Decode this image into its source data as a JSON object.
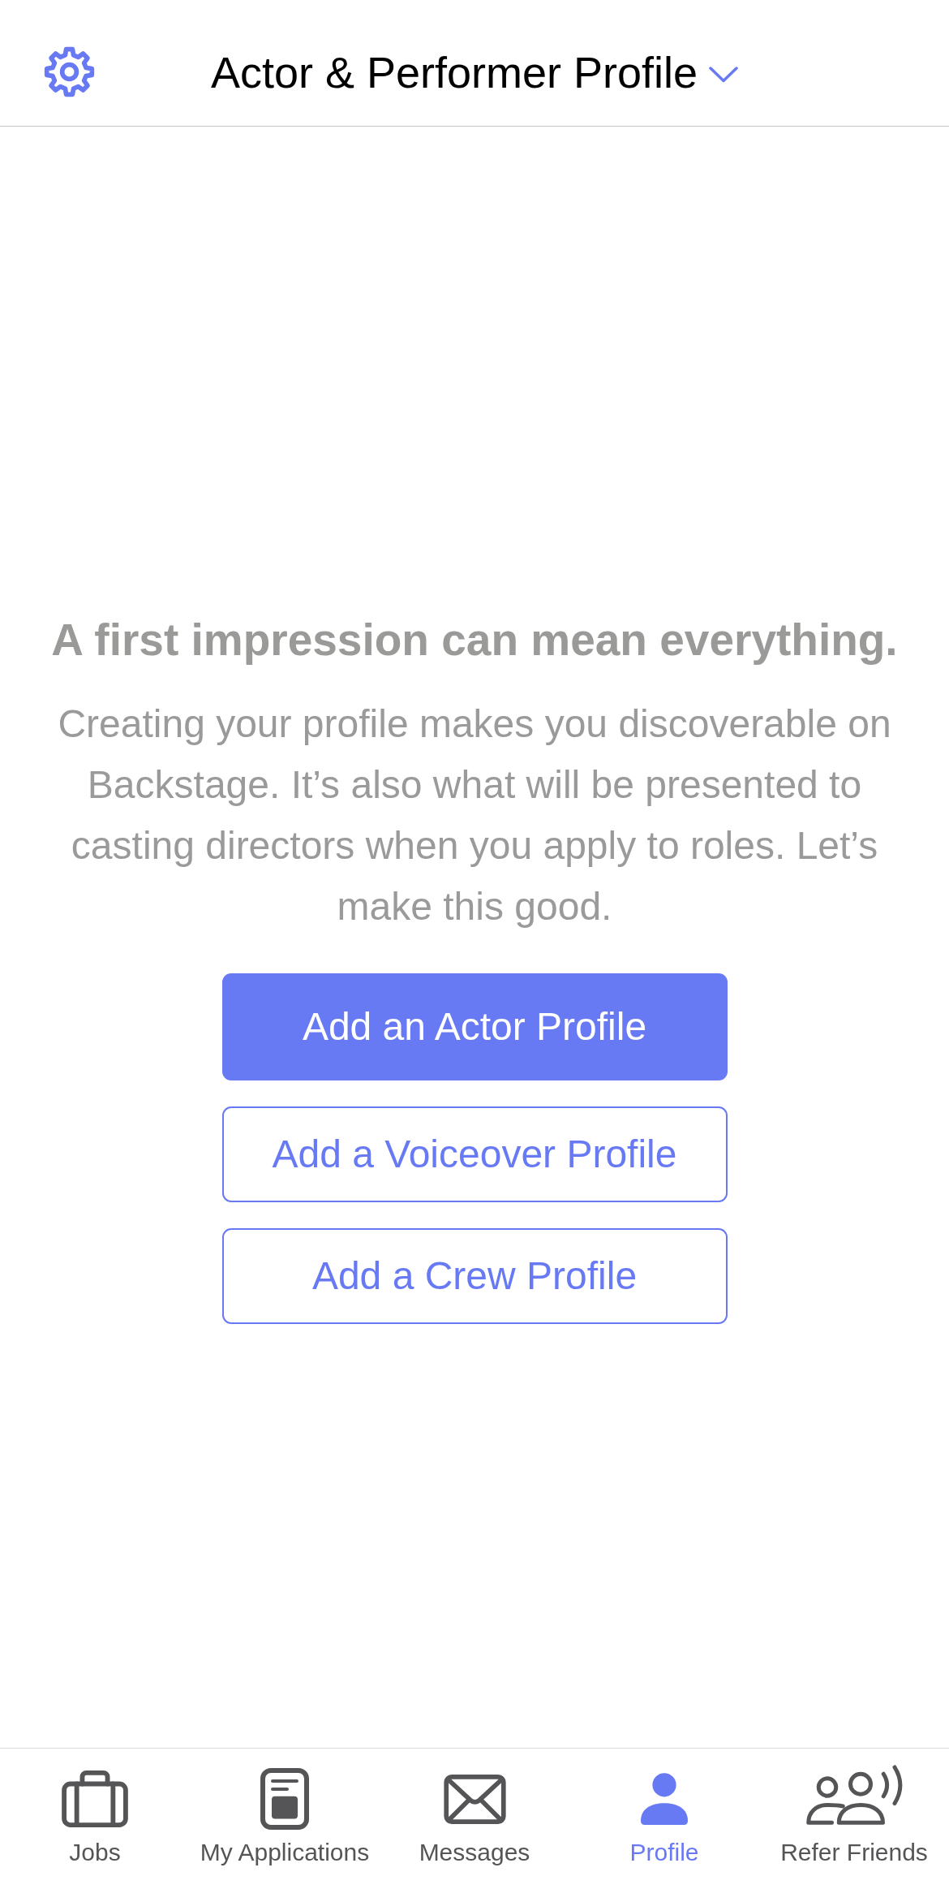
{
  "header": {
    "title": "Actor & Performer Profile"
  },
  "intro": {
    "heading": "A first impression can mean everything.",
    "body": "Creating your profile makes you discoverable on Backstage. It’s also what will be presented to casting directors when you apply to roles. Let’s make this good."
  },
  "actions": [
    {
      "label": "Add an Actor Profile",
      "kind": "primary"
    },
    {
      "label": "Add a Voiceover Profile",
      "kind": "outline"
    },
    {
      "label": "Add a Crew Profile",
      "kind": "outline"
    }
  ],
  "tab_bar": {
    "tabs": [
      {
        "label": "Jobs",
        "selected": false
      },
      {
        "label": "My Applications",
        "selected": false
      },
      {
        "label": "Messages",
        "selected": false
      },
      {
        "label": "Profile",
        "selected": true
      },
      {
        "label": "Refer Friends",
        "selected": false
      }
    ]
  }
}
